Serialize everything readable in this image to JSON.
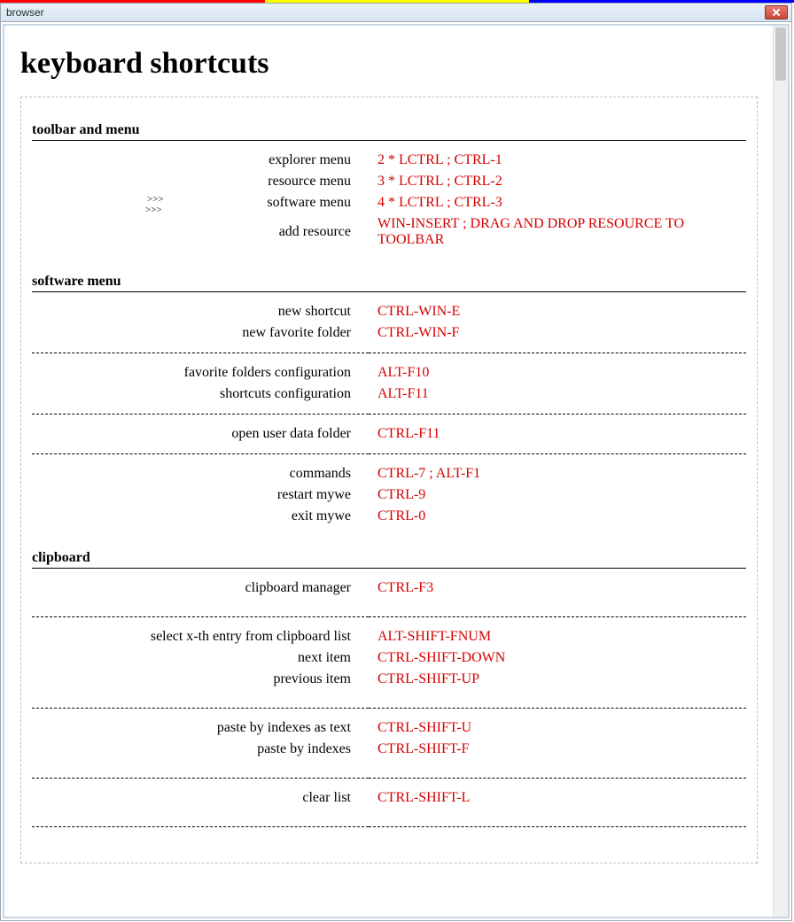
{
  "window": {
    "title": "browser"
  },
  "page": {
    "title": "keyboard shortcuts"
  },
  "markers": {
    "m1": ">>>",
    "m2": ">>>"
  },
  "sections": [
    {
      "title": "toolbar and menu",
      "groups": [
        [
          {
            "label": "explorer menu",
            "value": "2 * LCTRL ; CTRL-1"
          },
          {
            "label": "resource menu",
            "value": "3 * LCTRL ; CTRL-2"
          },
          {
            "label": "software menu",
            "value": "4 * LCTRL ; CTRL-3",
            "markers": true
          },
          {
            "label": "add resource",
            "value": "WIN-INSERT ; DRAG AND DROP RESOURCE TO TOOLBAR"
          }
        ]
      ]
    },
    {
      "title": "software menu",
      "groups": [
        [
          {
            "label": "new shortcut",
            "value": "CTRL-WIN-E"
          },
          {
            "label": "new favorite folder",
            "value": "CTRL-WIN-F"
          }
        ],
        [
          {
            "label": "favorite folders configuration",
            "value": "ALT-F10"
          },
          {
            "label": "shortcuts configuration",
            "value": "ALT-F11"
          }
        ],
        [
          {
            "label": "open user data folder",
            "value": "CTRL-F11"
          }
        ],
        [
          {
            "label": "commands",
            "value": "CTRL-7 ; ALT-F1"
          },
          {
            "label": "restart mywe",
            "value": "CTRL-9"
          },
          {
            "label": "exit mywe",
            "value": "CTRL-0"
          }
        ]
      ]
    },
    {
      "title": "clipboard",
      "groups": [
        [
          {
            "label": "clipboard manager",
            "value": "CTRL-F3"
          }
        ],
        [
          {
            "label": "select x-th entry from clipboard list",
            "value": "ALT-SHIFT-FNUM"
          },
          {
            "label": "next item",
            "value": "CTRL-SHIFT-DOWN"
          },
          {
            "label": "previous item",
            "value": "CTRL-SHIFT-UP"
          }
        ],
        [
          {
            "label": "paste by indexes as text",
            "value": "CTRL-SHIFT-U"
          },
          {
            "label": "paste by indexes",
            "value": "CTRL-SHIFT-F"
          }
        ],
        [
          {
            "label": "clear list",
            "value": "CTRL-SHIFT-L"
          }
        ]
      ],
      "gapGroups": true
    }
  ]
}
